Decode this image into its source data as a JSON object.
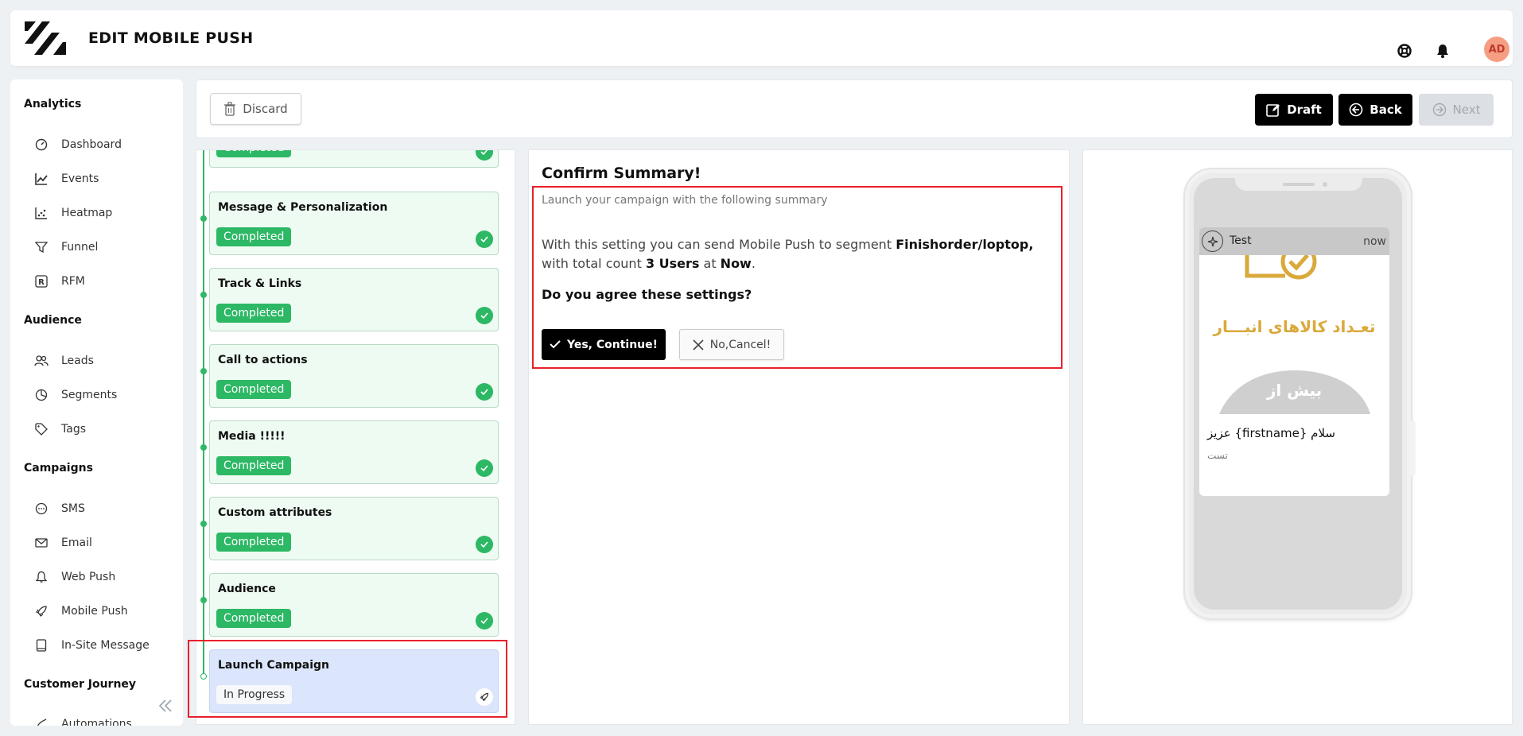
{
  "header": {
    "title": "EDIT MOBILE PUSH",
    "avatar_initials": "AD",
    "avatar_color": "#f59e83"
  },
  "sidebar": {
    "sections": [
      {
        "title": "Analytics",
        "items": [
          {
            "label": "Dashboard",
            "icon": "dashboard-icon"
          },
          {
            "label": "Events",
            "icon": "line-chart-icon"
          },
          {
            "label": "Heatmap",
            "icon": "scatter-icon"
          },
          {
            "label": "Funnel",
            "icon": "funnel-icon"
          },
          {
            "label": "RFM",
            "icon": "rfm-icon"
          }
        ]
      },
      {
        "title": "Audience",
        "items": [
          {
            "label": "Leads",
            "icon": "users-icon"
          },
          {
            "label": "Segments",
            "icon": "pie-icon"
          },
          {
            "label": "Tags",
            "icon": "tag-icon"
          }
        ]
      },
      {
        "title": "Campaigns",
        "items": [
          {
            "label": "SMS",
            "icon": "chat-icon"
          },
          {
            "label": "Email",
            "icon": "mail-icon"
          },
          {
            "label": "Web Push",
            "icon": "bell-icon"
          },
          {
            "label": "Mobile Push",
            "icon": "rocket-icon"
          },
          {
            "label": "In-Site Message",
            "icon": "tablet-icon"
          }
        ]
      },
      {
        "title": "Customer Journey",
        "items": [
          {
            "label": "Automations",
            "icon": "automation-icon"
          }
        ]
      }
    ]
  },
  "toolbar": {
    "discard_label": "Discard",
    "draft_label": "Draft",
    "back_label": "Back",
    "next_label": "Next"
  },
  "steps": [
    {
      "title": "",
      "status": "Completed"
    },
    {
      "title": "Message & Personalization",
      "status": "Completed"
    },
    {
      "title": "Track & Links",
      "status": "Completed"
    },
    {
      "title": "Call to actions",
      "status": "Completed"
    },
    {
      "title": "Media !!!!!",
      "status": "Completed"
    },
    {
      "title": "Custom attributes",
      "status": "Completed"
    },
    {
      "title": "Audience",
      "status": "Completed"
    },
    {
      "title": "Launch Campaign",
      "status": "In Progress"
    }
  ],
  "summary": {
    "title": "Confirm Summary!",
    "subtitle": "Launch your campaign with the following summary",
    "text_prefix": "With this setting you can send Mobile Push to segment ",
    "segment": "Finishorder/loptop,",
    "text_mid": " with total count ",
    "count": "3 Users",
    "text_at": " at ",
    "when": "Now",
    "text_end": ".",
    "question": "Do you agree these settings?",
    "yes_label": "Yes, Continue!",
    "no_label": "No,Cancel!"
  },
  "preview": {
    "app_name": "Test",
    "time": "now",
    "image_text_1": "تعـداد کالاهای انبـــار",
    "image_text_2": "بیش از",
    "title": "سلام {firstname} عزیز",
    "body": "تست"
  },
  "colors": {
    "accent_green": "#2cb864",
    "highlight_red": "#e8202a",
    "brand_dark": "#000000"
  }
}
